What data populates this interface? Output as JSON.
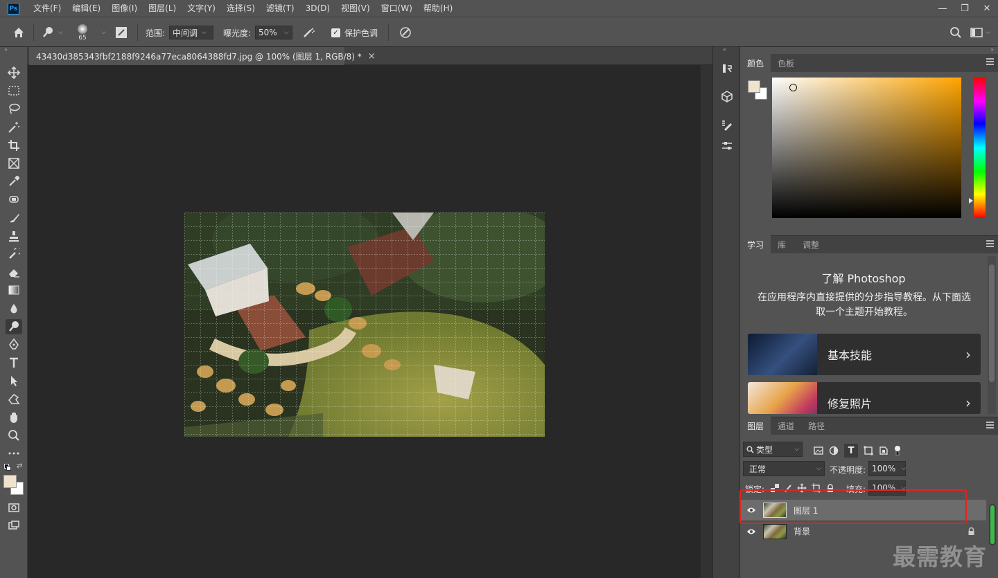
{
  "app": {
    "logo": "Ps"
  },
  "menu": [
    "文件(F)",
    "编辑(E)",
    "图像(I)",
    "图层(L)",
    "文字(Y)",
    "选择(S)",
    "滤镜(T)",
    "3D(D)",
    "视图(V)",
    "窗口(W)",
    "帮助(H)"
  ],
  "window_controls": {
    "minimize": "—",
    "restore": "❐",
    "close": "✕"
  },
  "options": {
    "brush_size": "65",
    "range_label": "范围:",
    "range_value": "中间调",
    "exposure_label": "曝光度:",
    "exposure_value": "50%",
    "protect_tones_label": "保护色调",
    "protect_tones_checked": true
  },
  "document": {
    "tab_title": "43430d385343fbf2188f9246a77eca8064388fd7.jpg @ 100% (图层 1, RGB/8) *",
    "close": "×"
  },
  "tools": [
    "move-tool",
    "marquee-tool",
    "lasso-tool",
    "magic-wand-tool",
    "crop-tool",
    "frame-tool",
    "eyedropper-tool",
    "spot-healing-tool",
    "brush-tool",
    "clone-stamp-tool",
    "history-brush-tool",
    "eraser-tool",
    "gradient-tool",
    "blur-tool",
    "dodge-tool",
    "pen-tool",
    "type-tool",
    "path-selection-tool",
    "shape-tool",
    "hand-tool",
    "zoom-tool",
    "more-tools"
  ],
  "colors": {
    "foreground": "#efe3cf",
    "background": "#ffffff",
    "accent": "#31a8ff",
    "highlight_box": "#e0241d"
  },
  "color_panel": {
    "tabs": [
      "颜色",
      "色板"
    ],
    "active": 0,
    "hue_base": "#ffa500"
  },
  "learn_panel": {
    "tabs": [
      "学习",
      "库",
      "调整"
    ],
    "title": "了解 Photoshop",
    "description": "在应用程序内直接提供的分步指导教程。从下面选取一个主题开始教程。",
    "cards": [
      {
        "label": "基本技能",
        "arrow": "›"
      },
      {
        "label": "修复照片",
        "arrow": "›"
      }
    ]
  },
  "layers_panel": {
    "tabs": [
      "图层",
      "通道",
      "路径"
    ],
    "filter_value": "类型",
    "blend_mode": "正常",
    "opacity_label": "不透明度:",
    "opacity_value": "100%",
    "lock_label": "锁定:",
    "fill_label": "填充:",
    "fill_value": "100%",
    "layers": [
      {
        "name": "图层 1",
        "selected": true,
        "visible": true,
        "locked": false
      },
      {
        "name": "背景",
        "selected": false,
        "visible": true,
        "locked": true
      }
    ]
  },
  "watermark": "最需教育"
}
